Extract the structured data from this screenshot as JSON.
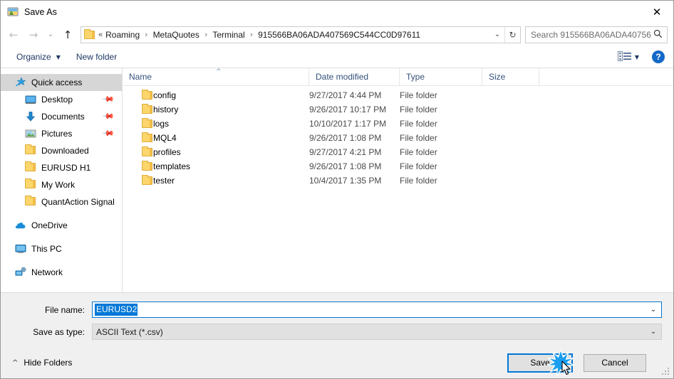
{
  "window": {
    "title": "Save As",
    "title_icon": "save-as-icon",
    "close_label": "✕"
  },
  "nav": {
    "back_icon": "←",
    "forward_icon": "→",
    "recent_icon": "⌄",
    "up_icon": "↑",
    "refresh_icon": "↻",
    "dropdown_icon": "⌄",
    "breadcrumb_overflow": "«",
    "breadcrumbs": [
      {
        "label": "Roaming"
      },
      {
        "label": "MetaQuotes"
      },
      {
        "label": "Terminal"
      },
      {
        "label": "915566BA06ADA407569C544CC0D97611"
      }
    ],
    "separator": "›"
  },
  "search": {
    "placeholder": "Search 915566BA06ADA40756...",
    "icon": "search-icon"
  },
  "commandbar": {
    "organize_label": "Organize",
    "organize_caret": "▼",
    "new_folder_label": "New folder",
    "view_caret": "▼",
    "help_label": "?"
  },
  "sidebar": {
    "items": [
      {
        "label": "Quick access",
        "icon": "star-icon",
        "selected": true,
        "indent": false,
        "pinned": false
      },
      {
        "label": "Desktop",
        "icon": "desktop-icon",
        "selected": false,
        "indent": true,
        "pinned": true
      },
      {
        "label": "Documents",
        "icon": "documents-icon",
        "selected": false,
        "indent": true,
        "pinned": true
      },
      {
        "label": "Pictures",
        "icon": "pictures-icon",
        "selected": false,
        "indent": true,
        "pinned": true
      },
      {
        "label": "Downloaded",
        "icon": "folder-icon",
        "selected": false,
        "indent": true,
        "pinned": false
      },
      {
        "label": "EURUSD H1",
        "icon": "folder-icon",
        "selected": false,
        "indent": true,
        "pinned": false
      },
      {
        "label": "My Work",
        "icon": "folder-icon",
        "selected": false,
        "indent": true,
        "pinned": false
      },
      {
        "label": "QuantAction Signal",
        "icon": "folder-icon",
        "selected": false,
        "indent": true,
        "pinned": false
      },
      {
        "label": "OneDrive",
        "icon": "onedrive-icon",
        "selected": false,
        "indent": false,
        "pinned": false,
        "gap_before": true
      },
      {
        "label": "This PC",
        "icon": "thispc-icon",
        "selected": false,
        "indent": false,
        "pinned": false,
        "gap_before": true
      },
      {
        "label": "Network",
        "icon": "network-icon",
        "selected": false,
        "indent": false,
        "pinned": false,
        "gap_before": true
      }
    ],
    "pin_icon": "pin-icon"
  },
  "filelist": {
    "columns": {
      "name": "Name",
      "date_modified": "Date modified",
      "type": "Type",
      "size": "Size"
    },
    "sort_indicator": "^",
    "rows": [
      {
        "name": "config",
        "date": "9/27/2017 4:44 PM",
        "type": "File folder",
        "size": ""
      },
      {
        "name": "history",
        "date": "9/26/2017 10:17 PM",
        "type": "File folder",
        "size": ""
      },
      {
        "name": "logs",
        "date": "10/10/2017 1:17 PM",
        "type": "File folder",
        "size": ""
      },
      {
        "name": "MQL4",
        "date": "9/26/2017 1:08 PM",
        "type": "File folder",
        "size": ""
      },
      {
        "name": "profiles",
        "date": "9/27/2017 4:21 PM",
        "type": "File folder",
        "size": ""
      },
      {
        "name": "templates",
        "date": "9/26/2017 1:08 PM",
        "type": "File folder",
        "size": ""
      },
      {
        "name": "tester",
        "date": "10/4/2017 1:35 PM",
        "type": "File folder",
        "size": ""
      }
    ]
  },
  "form": {
    "filename_label": "File name:",
    "filename_value": "EURUSD2",
    "filetype_label": "Save as type:",
    "filetype_value": "ASCII Text (*.csv)",
    "combo_caret": "⌄"
  },
  "footer": {
    "hide_folders_label": "Hide Folders",
    "hide_folders_caret": "^",
    "save_label": "Save",
    "cancel_label": "Cancel"
  },
  "colors": {
    "accent": "#0078d7",
    "folder": "#fcd66c",
    "header_text": "#34507a",
    "command_text": "#1f3864",
    "selection": "#d6d6d6"
  }
}
